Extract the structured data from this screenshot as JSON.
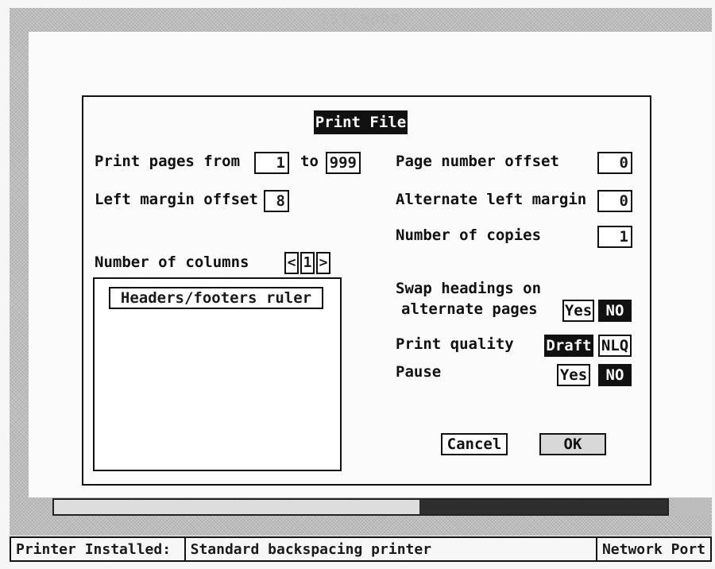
{
  "window": {
    "title": "1ST WORD"
  },
  "dialog": {
    "title": "Print File",
    "print_pages_from_label": "Print pages from",
    "from_value": "1",
    "to_label": "to",
    "to_value": "999",
    "left_margin_label": "Left margin offset",
    "left_margin_value": "8",
    "number_of_columns_label": "Number of columns",
    "columns_value": "1",
    "columns_prev": "<",
    "columns_next": ">",
    "headers_footers_label": "Headers/footers ruler",
    "page_number_offset_label": "Page number offset",
    "page_number_offset_value": "0",
    "alternate_left_margin_label": "Alternate left margin",
    "alternate_left_margin_value": "0",
    "number_of_copies_label": "Number of copies",
    "number_of_copies_value": "1",
    "swap_headings_line1": "Swap headings on",
    "swap_headings_line2": "alternate pages",
    "swap_yes": "Yes",
    "swap_no": "NO",
    "swap_selected": "NO",
    "print_quality_label": "Print quality",
    "quality_draft": "Draft",
    "quality_nlq": "NLQ",
    "quality_selected": "Draft",
    "pause_label": "Pause",
    "pause_yes": "Yes",
    "pause_no": "NO",
    "pause_selected": "NO",
    "cancel_label": "Cancel",
    "ok_label": "OK"
  },
  "statusbar": {
    "printer_installed_label": "Printer Installed:",
    "printer_name": "Standard backspacing printer",
    "port": "Network Port"
  },
  "colors": {
    "ink": "#111111",
    "paper": "#fbfbfb",
    "dither": "#c8c8c8"
  }
}
